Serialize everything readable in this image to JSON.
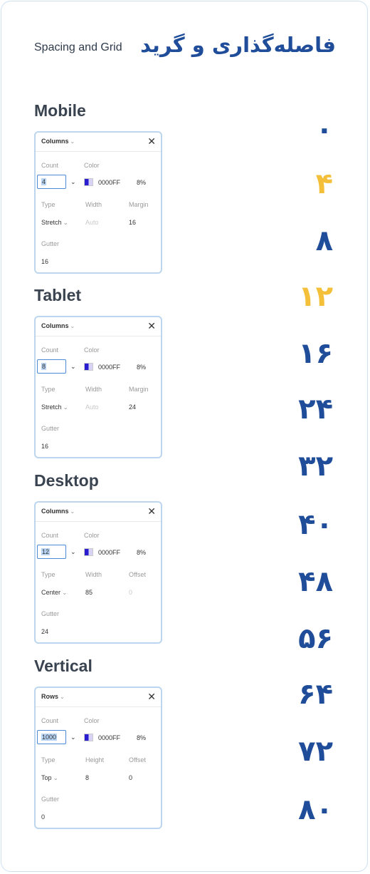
{
  "header": {
    "subtitle": "Spacing and Grid",
    "title_fa": "فاصله‌گذاری و گرید"
  },
  "panels": [
    {
      "section": "Mobile",
      "kind": "Columns",
      "count_label": "Count",
      "color_label": "Color",
      "count": "4",
      "hex": "0000FF",
      "opacity": "8%",
      "type_label": "Type",
      "mid_label": "Width",
      "right_label": "Margin",
      "type": "Stretch",
      "mid": "Auto",
      "right": "16",
      "gutter_label": "Gutter",
      "gutter": "16"
    },
    {
      "section": "Tablet",
      "kind": "Columns",
      "count_label": "Count",
      "color_label": "Color",
      "count": "8",
      "hex": "0000FF",
      "opacity": "8%",
      "type_label": "Type",
      "mid_label": "Width",
      "right_label": "Margin",
      "type": "Stretch",
      "mid": "Auto",
      "right": "24",
      "gutter_label": "Gutter",
      "gutter": "16"
    },
    {
      "section": "Desktop",
      "kind": "Columns",
      "count_label": "Count",
      "color_label": "Color",
      "count": "12",
      "hex": "0000FF",
      "opacity": "8%",
      "type_label": "Type",
      "mid_label": "Width",
      "right_label": "Offset",
      "type": "Center",
      "mid": "85",
      "right": "0",
      "gutter_label": "Gutter",
      "gutter": "24"
    },
    {
      "section": "Vertical",
      "kind": "Rows",
      "count_label": "Count",
      "color_label": "Color",
      "count": "1000",
      "hex": "0000FF",
      "opacity": "8%",
      "type_label": "Type",
      "mid_label": "Height",
      "right_label": "Offset",
      "type": "Top",
      "mid": "8",
      "right": "0",
      "gutter_label": "Gutter",
      "gutter": "0"
    }
  ],
  "spacing_scale": [
    "۰",
    "۴",
    "۸",
    "۱۲",
    "۱۶",
    "۲۴",
    "۳۲",
    "۴۰",
    "۴۸",
    "۵۶",
    "۶۴",
    "۷۲",
    "۸۰"
  ],
  "colors": {
    "primary": "#1f4d9a",
    "highlight": "#f4c039",
    "swatch": "#0000FF",
    "panel_border": "#bcd6ef"
  },
  "icons": {
    "close": "close-icon",
    "chevron": "chevron-down-icon"
  }
}
